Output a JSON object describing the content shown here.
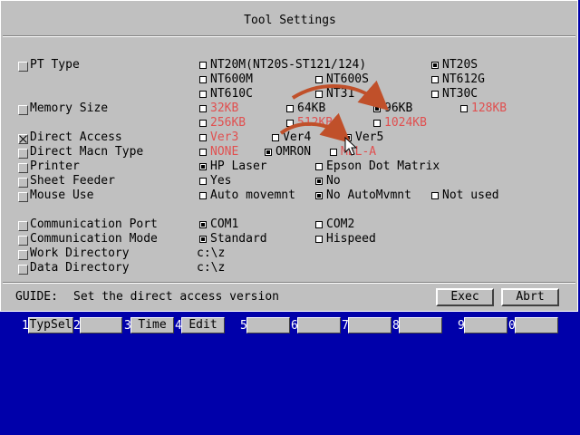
{
  "window": {
    "title": "Tool Settings"
  },
  "settings": {
    "pt_type": {
      "label": "PT Type",
      "options": [
        "NT20M(NT20S-ST121/124)",
        "NT20S",
        "NT600M",
        "NT600S",
        "NT612G",
        "NT610C",
        "NT31",
        "NT30C"
      ]
    },
    "memory_size": {
      "label": "Memory Size",
      "options": [
        "32KB",
        "64KB",
        "96KB",
        "128KB",
        "256KB",
        "512KB",
        "1024KB"
      ]
    },
    "direct_access": {
      "label": "Direct Access",
      "options": [
        "Ver3",
        "Ver4",
        "Ver5"
      ]
    },
    "direct_macn": {
      "label": "Direct Macn Type",
      "options": [
        "NONE",
        "OMRON",
        "MEL-A"
      ]
    },
    "printer": {
      "label": "Printer",
      "options": [
        "HP Laser",
        "Epson Dot Matrix"
      ]
    },
    "sheet_feeder": {
      "label": "Sheet Feeder",
      "options": [
        "Yes",
        "No"
      ]
    },
    "mouse_use": {
      "label": "Mouse Use",
      "options": [
        "Auto movemnt",
        "No AutoMvmnt",
        "Not used"
      ]
    },
    "comm_port": {
      "label": "Communication Port",
      "options": [
        "COM1",
        "COM2"
      ]
    },
    "comm_mode": {
      "label": "Communication Mode",
      "options": [
        "Standard",
        "Hispeed"
      ]
    },
    "work_dir": {
      "label": "Work Directory",
      "value": "c:\\z"
    },
    "data_dir": {
      "label": "Data Directory",
      "value": "c:\\z"
    }
  },
  "guide": {
    "label": "GUIDE:",
    "text": "Set the direct access version"
  },
  "buttons": {
    "exec": "Exec",
    "abort": "Abrt"
  },
  "fkeys": [
    {
      "num": "1",
      "label": "TypSel"
    },
    {
      "num": "2",
      "label": ""
    },
    {
      "num": "3",
      "label": "Time"
    },
    {
      "num": "4",
      "label": "Edit"
    },
    {
      "num": "5",
      "label": ""
    },
    {
      "num": "6",
      "label": ""
    },
    {
      "num": "7",
      "label": ""
    },
    {
      "num": "8",
      "label": ""
    },
    {
      "num": "9",
      "label": ""
    },
    {
      "num": "0",
      "label": ""
    }
  ],
  "colors": {
    "desktop": "#0000aa",
    "dialog": "#c0c0c0",
    "disabled_text": "#e05050",
    "annotation_arrow": "#c0502a"
  }
}
